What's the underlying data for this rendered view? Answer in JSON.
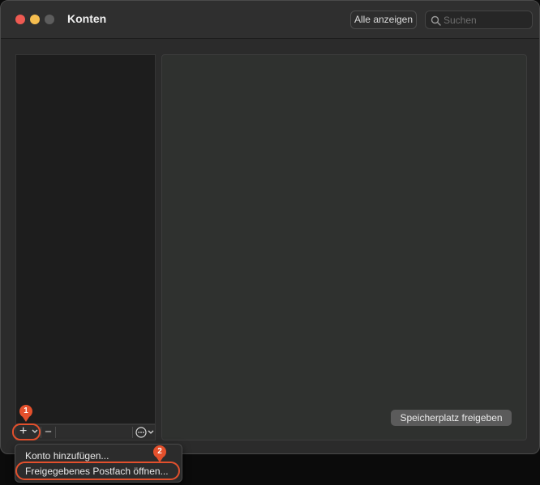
{
  "window": {
    "title": "Konten"
  },
  "toolbar": {
    "show_all_label": "Alle anzeigen",
    "search_placeholder": "Suchen"
  },
  "main": {
    "storage_button_label": "Speicherplatz freigeben"
  },
  "bottom_bar": {
    "add_symbol": "+",
    "remove_symbol": "−"
  },
  "menu": {
    "items": [
      {
        "label": "Konto hinzufügen..."
      },
      {
        "label": "Freigegebenes Postfach öffnen..."
      }
    ]
  },
  "annotations": {
    "step_1": "1",
    "step_2": "2",
    "highlight_color": "#e4502c"
  },
  "colors": {
    "close": "#ee5a52",
    "minimize": "#f5bd4f",
    "zoom_inactive": "#5d5d5d"
  }
}
